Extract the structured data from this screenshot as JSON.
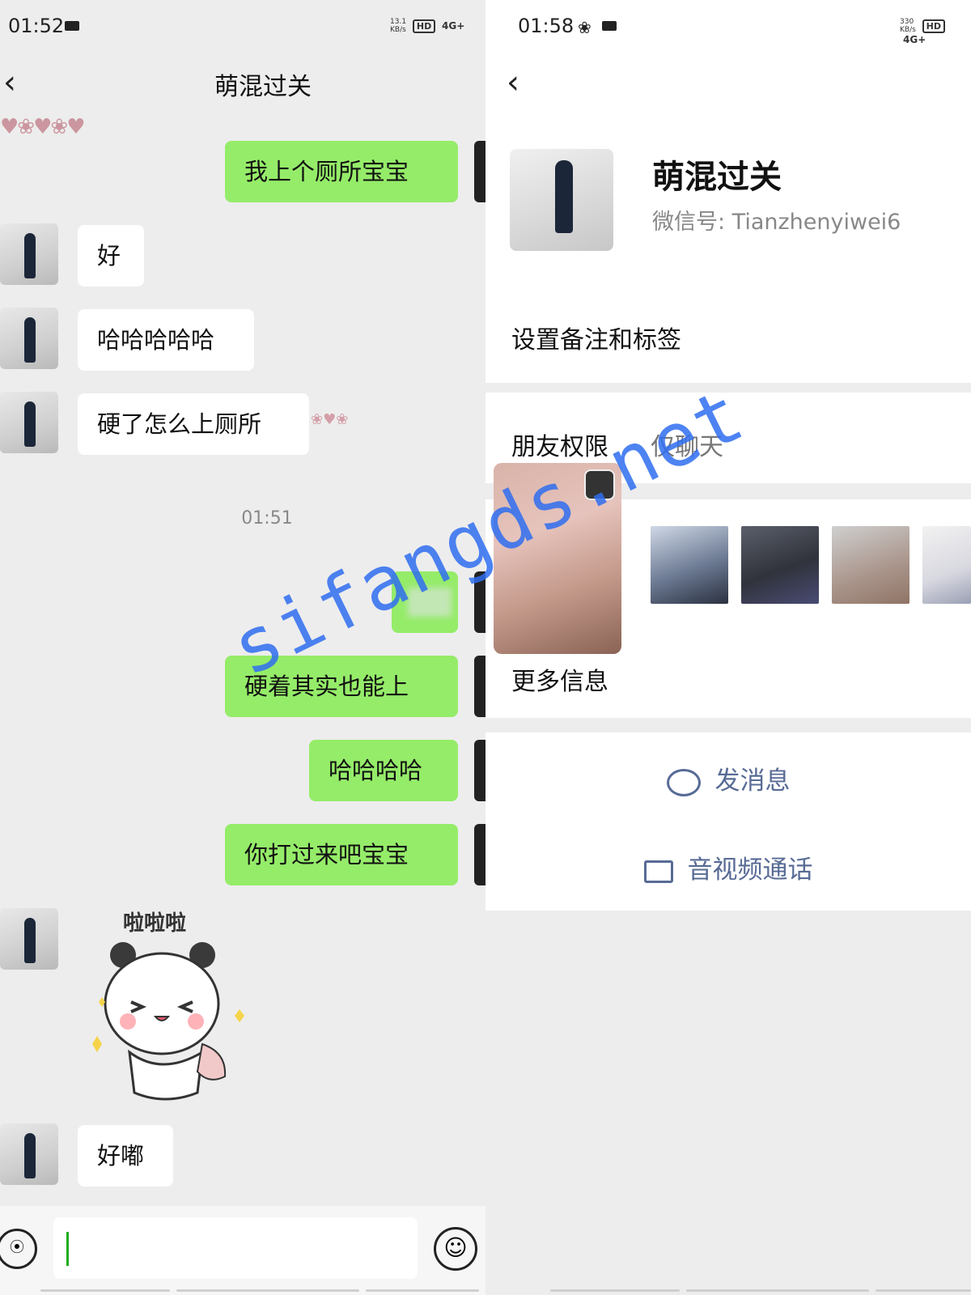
{
  "left": {
    "status": {
      "time": "01:52",
      "speed": "13.1\nKB/s",
      "hd": "HD",
      "net": "4G+"
    },
    "title": "萌混过关",
    "top_decor": "",
    "messages": [
      {
        "side": "me",
        "text": "我上个厕所宝宝"
      },
      {
        "side": "them",
        "text": "好"
      },
      {
        "side": "them",
        "text": "哈哈哈哈哈"
      },
      {
        "side": "them",
        "text": "硬了怎么上厕所"
      },
      {
        "side": "me",
        "text": ""
      },
      {
        "side": "me",
        "text": "硬着其实也能上"
      },
      {
        "side": "me",
        "text": "哈哈哈哈"
      },
      {
        "side": "me",
        "text": "你打过来吧宝宝"
      },
      {
        "side": "them",
        "text": "好嘟"
      }
    ],
    "timestamp": "01:51",
    "sticker_text": "啦啦啦"
  },
  "right": {
    "status": {
      "time": "01:58",
      "speed": "330\nKB/s",
      "hd": "HD",
      "net": "4G+"
    },
    "name": "萌混过关",
    "wechat_id": "微信号: Tianzhenyiwei6",
    "remark": "设置备注和标签",
    "permission_label": "朋友权限",
    "permission_value": "仅聊天",
    "more_info": "更多信息",
    "send_message": "发消息",
    "call": "音视频通话"
  },
  "watermark": "sifangds.net",
  "colors": {
    "my_bubble": "#95ec69",
    "their_bubble": "#ffffff",
    "bg": "#ededed",
    "link": "#576b95",
    "watermark": "#2f6ef0"
  },
  "icons": [
    "back-icon",
    "voice-icon",
    "emoji-icon",
    "chat-icon",
    "video-icon"
  ]
}
